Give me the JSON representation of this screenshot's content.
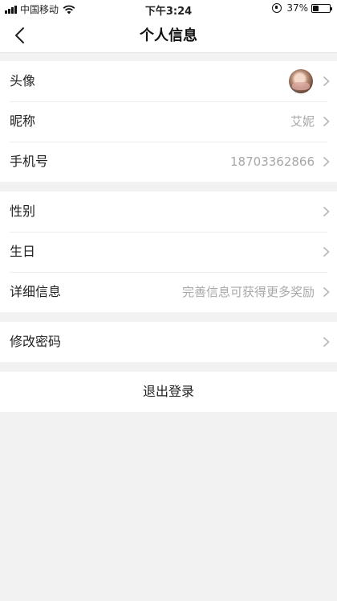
{
  "status_bar": {
    "carrier": "中国移动",
    "time": "下午3:24",
    "battery_percent": "37%",
    "battery_level": 0.37
  },
  "nav": {
    "title": "个人信息"
  },
  "groups": [
    {
      "rows": [
        {
          "label": "头像",
          "value": "",
          "avatar": true
        },
        {
          "label": "昵称",
          "value": "艾妮"
        },
        {
          "label": "手机号",
          "value": "18703362866"
        }
      ]
    },
    {
      "rows": [
        {
          "label": "性别",
          "value": ""
        },
        {
          "label": "生日",
          "value": ""
        },
        {
          "label": "详细信息",
          "value": "完善信息可获得更多奖励"
        }
      ]
    },
    {
      "rows": [
        {
          "label": "修改密码",
          "value": ""
        }
      ]
    }
  ],
  "logout_label": "退出登录"
}
